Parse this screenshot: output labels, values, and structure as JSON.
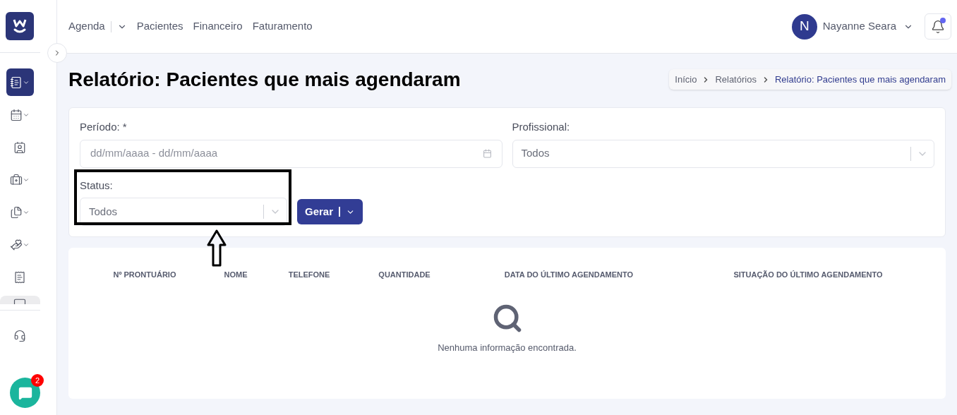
{
  "nav": {
    "items": [
      {
        "label": "Agenda",
        "has_menu": true
      },
      {
        "label": "Pacientes",
        "has_menu": false
      },
      {
        "label": "Financeiro",
        "has_menu": false
      },
      {
        "label": "Faturamento",
        "has_menu": false
      }
    ]
  },
  "user": {
    "initial": "N",
    "name": "Nayanne Seara",
    "has_notification": true
  },
  "sidebar": {
    "items": [
      {
        "selected": true,
        "has_menu": true
      },
      {
        "selected": false,
        "has_menu": true
      },
      {
        "selected": false,
        "has_menu": false
      },
      {
        "selected": false,
        "has_menu": true
      },
      {
        "selected": false,
        "has_menu": true
      },
      {
        "selected": false,
        "has_menu": true
      },
      {
        "selected": false,
        "has_menu": false
      }
    ],
    "chat_badge": "2"
  },
  "page_title": "Relatório: Pacientes que mais agendaram",
  "breadcrumb": [
    {
      "label": "Início",
      "current": false
    },
    {
      "label": "Relatórios",
      "current": false
    },
    {
      "label": "Relatório: Pacientes que mais agendaram",
      "current": true
    }
  ],
  "filters": {
    "periodo": {
      "label": "Período: *",
      "placeholder": "dd/mm/aaaa - dd/mm/aaaa"
    },
    "profissional": {
      "label": "Profissional:",
      "value": "Todos"
    },
    "status": {
      "label": "Status:",
      "value": "Todos"
    },
    "generate_button": "Gerar"
  },
  "table": {
    "columns": [
      "Nº PRONTUÁRIO",
      "NOME",
      "TELEFONE",
      "QUANTIDADE",
      "DATA DO ÚLTIMO AGENDAMENTO",
      "SITUAÇÃO DO ÚLTIMO AGENDAMENTO"
    ],
    "empty_message": "Nenhuma informação encontrada."
  }
}
